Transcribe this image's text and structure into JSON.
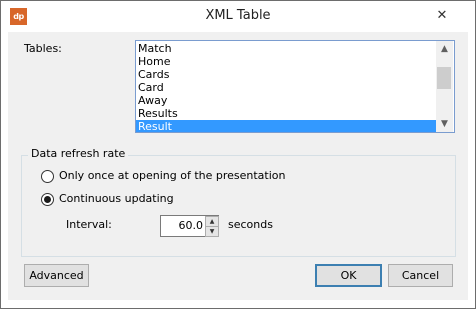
{
  "window": {
    "title": "XML Table",
    "icon_text": "dp",
    "close_glyph": "✕"
  },
  "tables": {
    "label": "Tables:",
    "items": [
      "Match",
      "Home",
      "Cards",
      "Card",
      "Away",
      "Results",
      "Result"
    ],
    "selected": "Result"
  },
  "refresh": {
    "group_title": "Data refresh rate",
    "option_once": "Only once at opening of the presentation",
    "option_continuous": "Continuous updating",
    "selected_option": "Continuous updating",
    "interval_label": "Interval:",
    "interval_value": "60.0",
    "unit_label": "seconds"
  },
  "buttons": {
    "advanced": "Advanced",
    "ok": "OK",
    "cancel": "Cancel"
  },
  "icons": {
    "app": "dp-logo-icon",
    "close": "close-icon",
    "scroll_up": "chevron-up-icon",
    "scroll_down": "chevron-down-icon",
    "spin_up": "spin-up-icon",
    "spin_down": "spin-down-icon"
  },
  "colors": {
    "selection": "#3399ff",
    "app_icon": "#d8672a",
    "default_button_border": "#3c7fb1"
  }
}
